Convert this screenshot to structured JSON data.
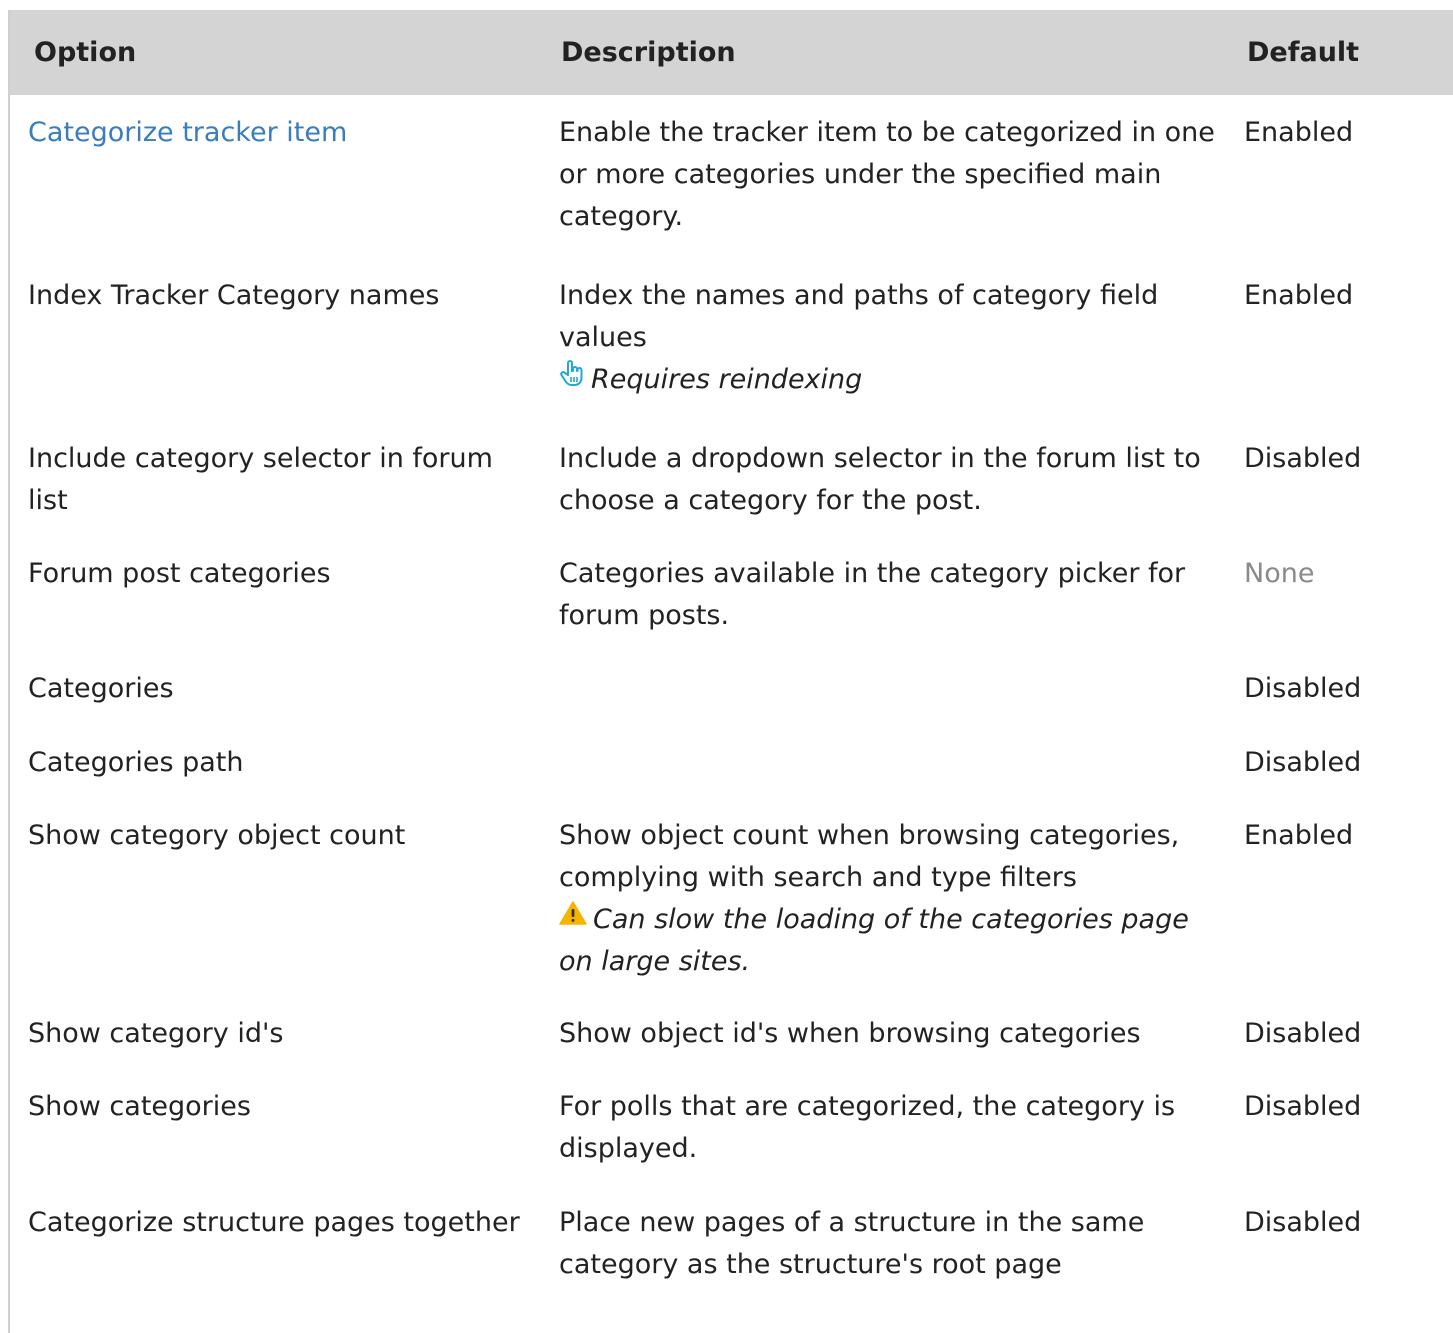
{
  "headers": {
    "option": "Option",
    "description": "Description",
    "default": "Default"
  },
  "rows": [
    {
      "option": "Categorize tracker item",
      "option_is_link": true,
      "description": "Enable the tracker item to be categorized in one or more categories under the specified main category.",
      "default": "Enabled"
    },
    {
      "option": "Index Tracker Category names",
      "description": "Index the names and paths of category field values",
      "note": "Requires reindexing",
      "note_icon": "pointing-hand-icon",
      "default": "Enabled"
    },
    {
      "option": "Include category selector in forum list",
      "description": "Include a dropdown selector in the forum list to choose a category for the post.",
      "default": "Disabled"
    },
    {
      "option": "Forum post categories",
      "description": "Categories available in the category picker for forum posts.",
      "default": "None"
    },
    {
      "option": "Categories",
      "description": "",
      "default": "Disabled"
    },
    {
      "option": "Categories path",
      "description": "",
      "default": "Disabled"
    },
    {
      "option": "Show category object count",
      "description": "Show object count when browsing categories, complying with search and type filters",
      "note": "Can slow the loading of the categories page on large sites.",
      "note_icon": "warning-icon",
      "default": "Enabled"
    },
    {
      "option": "Show category id's",
      "description": "Show object id's when browsing categories",
      "default": "Disabled"
    },
    {
      "option": "Show categories",
      "description": "For polls that are categorized, the category is displayed.",
      "default": "Disabled"
    },
    {
      "option": "Categorize structure pages together",
      "description": "Place new pages of a structure in the same category as the structure's root page",
      "default": "Disabled"
    }
  ],
  "colors": {
    "header_bg": "#d4d4d4",
    "link": "#3a7dbd",
    "muted": "#8a8a8a",
    "hand_icon": "#1fa8d8",
    "warning_icon": "#f5b400"
  }
}
